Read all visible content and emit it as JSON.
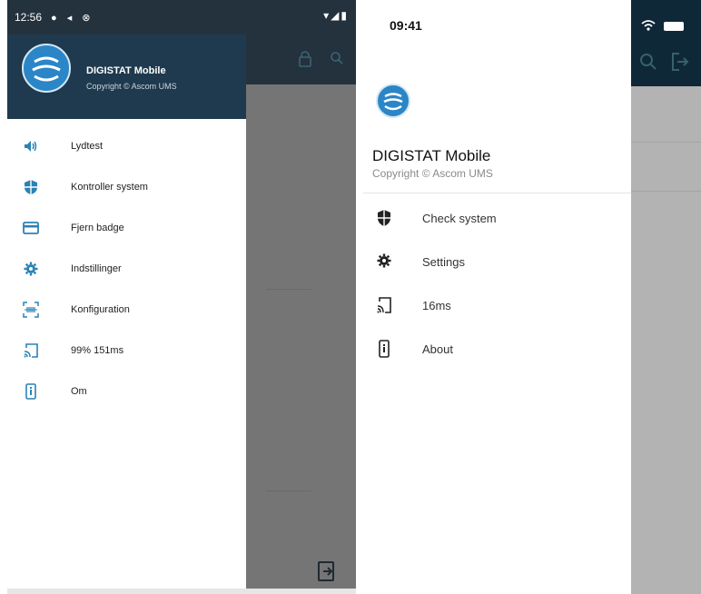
{
  "android": {
    "status_time": "12:56",
    "app_title": "DIGISTAT Mobile",
    "copyright": "Copyright © Ascom UMS",
    "menu": [
      {
        "icon": "speaker-icon",
        "label": "Lydtest"
      },
      {
        "icon": "shield-icon",
        "label": "Kontroller system"
      },
      {
        "icon": "badge-card-icon",
        "label": "Fjern badge"
      },
      {
        "icon": "gear-icon",
        "label": "Indstillinger"
      },
      {
        "icon": "barcode-scan-icon",
        "label": "Konfiguration"
      },
      {
        "icon": "cast-icon",
        "label": "99% 151ms"
      },
      {
        "icon": "phone-info-icon",
        "label": "Om"
      }
    ]
  },
  "ios": {
    "status_time": "09:41",
    "app_title": "DIGISTAT Mobile",
    "copyright": "Copyright © Ascom UMS",
    "menu": [
      {
        "icon": "shield-icon",
        "label": "Check system"
      },
      {
        "icon": "gear-icon",
        "label": "Settings"
      },
      {
        "icon": "cast-icon",
        "label": "16ms"
      },
      {
        "icon": "phone-info-icon",
        "label": "About"
      }
    ]
  },
  "colors": {
    "header_dark": "#1f3a4e",
    "accent_blue": "#2a82b5",
    "scrim_gray": "#757575"
  }
}
